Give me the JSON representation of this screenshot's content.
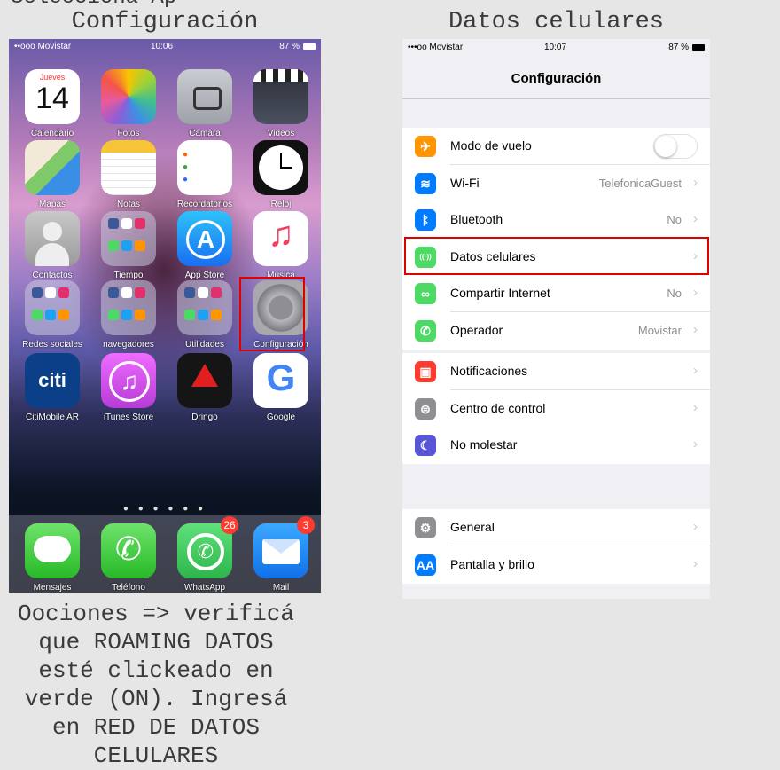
{
  "captions": {
    "top_cut": "Selecciona Ap",
    "left": "Configuración",
    "right": "Datos celulares",
    "instructions": "Oociones => verificá que ROAMING DATOS esté clickeado en verde (ON). Ingresá en RED DE DATOS CELULARES"
  },
  "home_screen": {
    "status": {
      "carrier": "••ooo Movistar",
      "time": "10:06",
      "battery": "87 %"
    },
    "rows": [
      [
        {
          "label": "Calendario",
          "icon": "calendar-icon",
          "day_name": "Jueves",
          "day_number": "14"
        },
        {
          "label": "Fotos",
          "icon": "photos-icon"
        },
        {
          "label": "Cámara",
          "icon": "camera-icon"
        },
        {
          "label": "Videos",
          "icon": "videos-icon"
        }
      ],
      [
        {
          "label": "Mapas",
          "icon": "maps-icon"
        },
        {
          "label": "Notas",
          "icon": "notes-icon"
        },
        {
          "label": "Recordatorios",
          "icon": "reminders-icon"
        },
        {
          "label": "Reloj",
          "icon": "clock-icon"
        }
      ],
      [
        {
          "label": "Contactos",
          "icon": "contacts-icon"
        },
        {
          "label": "Tiempo",
          "icon": "weather-folder-icon"
        },
        {
          "label": "App Store",
          "icon": "app-store-icon"
        },
        {
          "label": "Música",
          "icon": "music-icon"
        }
      ],
      [
        {
          "label": "Redes sociales",
          "icon": "social-folder-icon"
        },
        {
          "label": "navegadores",
          "icon": "browsers-folder-icon"
        },
        {
          "label": "Utilidades",
          "icon": "utilities-folder-icon"
        },
        {
          "label": "Configuración",
          "icon": "settings-icon"
        }
      ],
      [
        {
          "label": "CitiMobile AR",
          "icon": "citi-icon",
          "glyph": "citi"
        },
        {
          "label": "iTunes Store",
          "icon": "itunes-store-icon"
        },
        {
          "label": "Dringo",
          "icon": "dringo-icon"
        },
        {
          "label": "Google",
          "icon": "google-icon",
          "glyph": "G"
        }
      ]
    ],
    "dock": [
      {
        "label": "Mensajes",
        "icon": "messages-icon"
      },
      {
        "label": "Teléfono",
        "icon": "phone-icon"
      },
      {
        "label": "WhatsApp",
        "icon": "whatsapp-icon",
        "badge": "26"
      },
      {
        "label": "Mail",
        "icon": "mail-icon",
        "badge": "3"
      }
    ],
    "page_dots": "● ● ● ● ● ●"
  },
  "settings_screen": {
    "status": {
      "carrier": "•••oo Movistar",
      "time": "10:07",
      "battery": "87 %"
    },
    "title": "Configuración",
    "groups": [
      [
        {
          "label": "Modo de vuelo",
          "value": "",
          "toggle": true,
          "color": "#ff9500",
          "glyph": "✈"
        },
        {
          "label": "Wi-Fi",
          "value": "TelefonicaGuest",
          "color": "#007aff",
          "glyph": "≋"
        },
        {
          "label": "Bluetooth",
          "value": "No",
          "color": "#007aff",
          "glyph": "ᛒ"
        },
        {
          "label": "Datos celulares",
          "value": "",
          "color": "#4cd964",
          "glyph": "((·))",
          "highlighted": true
        },
        {
          "label": "Compartir Internet",
          "value": "No",
          "color": "#4cd964",
          "glyph": "∞"
        },
        {
          "label": "Operador",
          "value": "Movistar",
          "color": "#4cd964",
          "glyph": "✆"
        }
      ],
      [
        {
          "label": "Notificaciones",
          "value": "",
          "color": "#ff3b30",
          "glyph": "▣"
        },
        {
          "label": "Centro de control",
          "value": "",
          "color": "#8e8e93",
          "glyph": "⊜"
        },
        {
          "label": "No molestar",
          "value": "",
          "color": "#5856d6",
          "glyph": "☾"
        }
      ],
      [
        {
          "label": "General",
          "value": "",
          "color": "#8e8e93",
          "glyph": "⚙"
        },
        {
          "label": "Pantalla y brillo",
          "value": "",
          "color": "#007aff",
          "glyph": "AA"
        }
      ]
    ]
  }
}
